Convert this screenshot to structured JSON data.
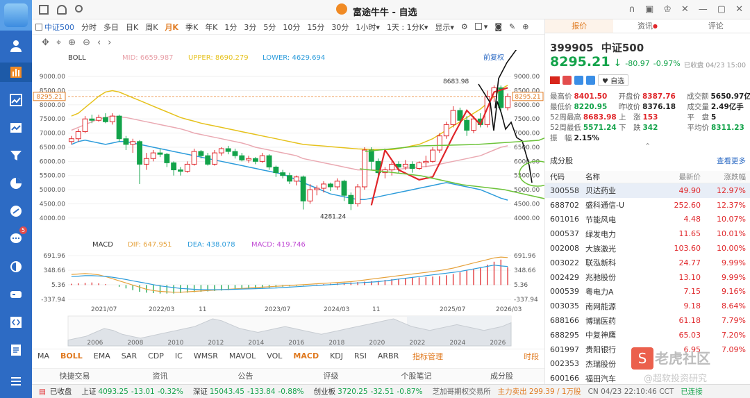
{
  "window": {
    "title": "富途牛牛 - 自选"
  },
  "toolbar": {
    "index_checkbox_label": "中证500",
    "periods": [
      "分时",
      "多日",
      "日K",
      "周K",
      "月K",
      "季K",
      "年K",
      "1分",
      "3分",
      "5分",
      "10分",
      "15分",
      "30分",
      "1小时▾",
      "1天 : 1分K▾",
      "显示▾"
    ],
    "active_period": "月K",
    "prev_adj_label": "前复权"
  },
  "boll": {
    "label": "BOLL",
    "mid_label": "MID:",
    "mid": "6659.987",
    "upper_label": "UPPER:",
    "upper": "8690.279",
    "lower_label": "LOWER:",
    "lower": "4629.694"
  },
  "macd": {
    "label": "MACD",
    "dif_label": "DIF:",
    "dif": "647.951",
    "dea_label": "DEA:",
    "dea": "438.078",
    "macd_label": "MACD:",
    "macd": "419.746"
  },
  "chart_data": [
    {
      "type": "candlestick",
      "title": "",
      "y_axis_ticks": [
        "9000.00",
        "8500.00",
        "8000.00",
        "7500.00",
        "7000.00",
        "6500.00",
        "6000.00",
        "5500.00",
        "5000.00",
        "4500.00",
        "4000.00"
      ],
      "ylim": [
        3750,
        9150
      ],
      "current_price_tag": "8295.21",
      "max_label": "8683.98",
      "min_label": "4281.24",
      "x_axis_labels": [
        "2021/07",
        "2022/03",
        "11",
        "2023/07",
        "2024/03",
        "11",
        "2025/07",
        "2026/03"
      ],
      "candles": [
        {
          "o": 6700,
          "c": 6800,
          "h": 6900,
          "l": 6600
        },
        {
          "o": 6800,
          "c": 7050,
          "h": 7150,
          "l": 6700
        },
        {
          "o": 7050,
          "c": 7500,
          "h": 7600,
          "l": 7000
        },
        {
          "o": 7500,
          "c": 7450,
          "h": 7650,
          "l": 7350
        },
        {
          "o": 7450,
          "c": 7550,
          "h": 7650,
          "l": 7400
        },
        {
          "o": 7550,
          "c": 7400,
          "h": 7700,
          "l": 7350
        },
        {
          "o": 7400,
          "c": 7600,
          "h": 7700,
          "l": 7300
        },
        {
          "o": 7600,
          "c": 6800,
          "h": 7650,
          "l": 6700
        },
        {
          "o": 6800,
          "c": 6600,
          "h": 6900,
          "l": 6400
        },
        {
          "o": 6600,
          "c": 6700,
          "h": 6800,
          "l": 6300
        },
        {
          "o": 6700,
          "c": 5900,
          "h": 6750,
          "l": 5200
        },
        {
          "o": 5900,
          "c": 6100,
          "h": 6300,
          "l": 5700
        },
        {
          "o": 6100,
          "c": 6300,
          "h": 6400,
          "l": 6000
        },
        {
          "o": 6300,
          "c": 6250,
          "h": 6450,
          "l": 6150
        },
        {
          "o": 6250,
          "c": 5950,
          "h": 6300,
          "l": 5800
        },
        {
          "o": 5950,
          "c": 5700,
          "h": 6000,
          "l": 5500
        },
        {
          "o": 5700,
          "c": 5650,
          "h": 5800,
          "l": 5500
        },
        {
          "o": 5650,
          "c": 5900,
          "h": 6000,
          "l": 5600
        },
        {
          "o": 5900,
          "c": 6350,
          "h": 6450,
          "l": 5850
        },
        {
          "o": 6350,
          "c": 6200,
          "h": 6400,
          "l": 6100
        },
        {
          "o": 6200,
          "c": 5900,
          "h": 6300,
          "l": 5850
        },
        {
          "o": 5900,
          "c": 6300,
          "h": 6400,
          "l": 5850
        },
        {
          "o": 6300,
          "c": 6450,
          "h": 6500,
          "l": 6200
        },
        {
          "o": 6450,
          "c": 6350,
          "h": 6550,
          "l": 6250
        },
        {
          "o": 6350,
          "c": 6200,
          "h": 6450,
          "l": 6100
        },
        {
          "o": 6200,
          "c": 6050,
          "h": 6300,
          "l": 6000
        },
        {
          "o": 6050,
          "c": 6100,
          "h": 6200,
          "l": 5950
        },
        {
          "o": 6100,
          "c": 6000,
          "h": 6150,
          "l": 5900
        },
        {
          "o": 6000,
          "c": 6200,
          "h": 6300,
          "l": 5950
        },
        {
          "o": 6200,
          "c": 5800,
          "h": 6250,
          "l": 5700
        },
        {
          "o": 5800,
          "c": 5600,
          "h": 5850,
          "l": 5450
        },
        {
          "o": 5600,
          "c": 5500,
          "h": 5700,
          "l": 5400
        },
        {
          "o": 5500,
          "c": 5300,
          "h": 5600,
          "l": 5200
        },
        {
          "o": 5300,
          "c": 5450,
          "h": 5500,
          "l": 5150
        },
        {
          "o": 5450,
          "c": 4600,
          "h": 5500,
          "l": 4300
        },
        {
          "o": 4600,
          "c": 5000,
          "h": 5200,
          "l": 4500
        },
        {
          "o": 5000,
          "c": 5050,
          "h": 5150,
          "l": 4800
        },
        {
          "o": 5050,
          "c": 5200,
          "h": 5300,
          "l": 4900
        },
        {
          "o": 5200,
          "c": 5100,
          "h": 5250,
          "l": 4950
        },
        {
          "o": 5100,
          "c": 5300,
          "h": 5400,
          "l": 5000
        },
        {
          "o": 5300,
          "c": 4800,
          "h": 5350,
          "l": 4600
        },
        {
          "o": 4800,
          "c": 4500,
          "h": 4900,
          "l": 4281
        },
        {
          "o": 4500,
          "c": 5100,
          "h": 5200,
          "l": 4400
        },
        {
          "o": 5100,
          "c": 6400,
          "h": 6500,
          "l": 5000
        },
        {
          "o": 6400,
          "c": 6000,
          "h": 6500,
          "l": 5700
        },
        {
          "o": 6000,
          "c": 5600,
          "h": 6100,
          "l": 5400
        },
        {
          "o": 5600,
          "c": 5700,
          "h": 5800,
          "l": 5400
        },
        {
          "o": 5700,
          "c": 5900,
          "h": 6000,
          "l": 5500
        },
        {
          "o": 5900,
          "c": 5800,
          "h": 6000,
          "l": 5600
        },
        {
          "o": 5800,
          "c": 5900,
          "h": 6050,
          "l": 5700
        },
        {
          "o": 5900,
          "c": 5750,
          "h": 6000,
          "l": 5600
        },
        {
          "o": 5750,
          "c": 5950,
          "h": 6000,
          "l": 5700
        },
        {
          "o": 5950,
          "c": 6000,
          "h": 6200,
          "l": 5800
        },
        {
          "o": 6000,
          "c": 6400,
          "h": 6500,
          "l": 5950
        },
        {
          "o": 6400,
          "c": 6900,
          "h": 7000,
          "l": 6300
        },
        {
          "o": 6900,
          "c": 7300,
          "h": 7400,
          "l": 6800
        },
        {
          "o": 7300,
          "c": 7800,
          "h": 7950,
          "l": 7200
        },
        {
          "o": 7800,
          "c": 7450,
          "h": 7900,
          "l": 7300
        },
        {
          "o": 7450,
          "c": 7100,
          "h": 7600,
          "l": 6900
        },
        {
          "o": 7100,
          "c": 7500,
          "h": 7600,
          "l": 7000
        },
        {
          "o": 7500,
          "c": 7300,
          "h": 7700,
          "l": 7200
        },
        {
          "o": 7300,
          "c": 8300,
          "h": 8500,
          "l": 7200
        },
        {
          "o": 8300,
          "c": 8600,
          "h": 8684,
          "l": 8100
        },
        {
          "o": 8600,
          "c": 7900,
          "h": 8680,
          "l": 7700
        },
        {
          "o": 7900,
          "c": 8295,
          "h": 8400,
          "l": 7800
        }
      ],
      "mid_line": [
        7100,
        7200,
        7300,
        7400,
        7500,
        7550,
        7600,
        7580,
        7550,
        7500,
        7450,
        7400,
        7350,
        7300,
        7250,
        7200,
        7150,
        7080,
        7000,
        6950,
        6900,
        6850,
        6800,
        6750,
        6700,
        6650,
        6580,
        6500,
        6450,
        6400,
        6350,
        6300,
        6250,
        6200,
        6100,
        6050,
        6000,
        5950,
        5900,
        5850,
        5800,
        5750,
        5700,
        5700,
        5700,
        5700,
        5700,
        5700,
        5720,
        5750,
        5780,
        5800,
        5820,
        5850,
        5900,
        5950,
        6000,
        6050,
        6100,
        6150,
        6200,
        6300,
        6400,
        6500,
        6550
      ],
      "upper_line": [
        7600,
        7700,
        7900,
        8100,
        8300,
        8450,
        8500,
        8450,
        8350,
        8250,
        8150,
        8050,
        7950,
        7850,
        7750,
        7650,
        7550,
        7480,
        7420,
        7350,
        7300,
        7250,
        7200,
        7150,
        7100,
        7050,
        7000,
        6950,
        6900,
        6850,
        6800,
        6750,
        6700,
        6650,
        6600,
        6580,
        6560,
        6540,
        6520,
        6500,
        6480,
        6460,
        6440,
        6430,
        6420,
        6420,
        6420,
        6420,
        6450,
        6500,
        6550,
        6600,
        6700,
        6800,
        6950,
        7100,
        7250,
        7400,
        7550,
        7700,
        7850,
        8050,
        8300,
        8550,
        8690
      ],
      "lower_line": [
        6600,
        6700,
        6750,
        6700,
        6650,
        6600,
        6650,
        6700,
        6700,
        6650,
        6600,
        6550,
        6500,
        6450,
        6400,
        6350,
        6300,
        6250,
        6200,
        6150,
        6100,
        6050,
        6000,
        5950,
        5900,
        5850,
        5800,
        5750,
        5700,
        5650,
        5600,
        5550,
        5450,
        5350,
        5250,
        5150,
        5050,
        4950,
        4850,
        4800,
        4750,
        4700,
        4650,
        4650,
        4700,
        4750,
        4800,
        4850,
        4900,
        4950,
        5000,
        5050,
        5100,
        5150,
        5200,
        5250,
        5200,
        5150,
        5100,
        5050,
        5000,
        4900,
        4800,
        4700,
        4630
      ]
    },
    {
      "type": "bar",
      "title": "MACD",
      "y_axis_ticks": [
        "691.96",
        "348.66",
        "5.36",
        "-337.94"
      ],
      "ylim": [
        -420,
        760
      ],
      "histogram": [
        30,
        40,
        50,
        60,
        40,
        20,
        0,
        -40,
        -80,
        -120,
        -160,
        -180,
        -190,
        -200,
        -200,
        -200,
        -190,
        -180,
        -170,
        -160,
        -150,
        -140,
        -130,
        -120,
        -110,
        -100,
        -90,
        -80,
        -70,
        -60,
        -50,
        -40,
        -30,
        -20,
        -10,
        0,
        10,
        20,
        30,
        40,
        50,
        60,
        70,
        80,
        90,
        100,
        120,
        140,
        150,
        160,
        170,
        180,
        190,
        200,
        210,
        230,
        260,
        300,
        340,
        380,
        420,
        480,
        550,
        600,
        420
      ],
      "dif_line": [
        250,
        260,
        270,
        260,
        240,
        200,
        150,
        100,
        50,
        0,
        -50,
        -100,
        -130,
        -150,
        -160,
        -170,
        -170,
        -160,
        -150,
        -140,
        -130,
        -120,
        -110,
        -100,
        -90,
        -80,
        -70,
        -60,
        -50,
        -40,
        -30,
        -20,
        -10,
        0,
        10,
        20,
        30,
        40,
        50,
        60,
        70,
        80,
        100,
        120,
        140,
        160,
        180,
        200,
        220,
        240,
        260,
        280,
        300,
        320,
        340,
        370,
        400,
        440,
        480,
        520,
        560,
        600,
        640,
        660,
        648
      ],
      "dea_line": [
        200,
        210,
        220,
        220,
        215,
        205,
        185,
        160,
        130,
        100,
        70,
        40,
        10,
        -20,
        -40,
        -60,
        -80,
        -90,
        -100,
        -105,
        -110,
        -110,
        -108,
        -105,
        -100,
        -95,
        -90,
        -85,
        -80,
        -75,
        -70,
        -60,
        -50,
        -40,
        -30,
        -20,
        -10,
        0,
        10,
        20,
        30,
        40,
        50,
        60,
        70,
        80,
        100,
        120,
        140,
        160,
        180,
        200,
        220,
        240,
        260,
        280,
        300,
        320,
        350,
        380,
        410,
        440,
        470,
        450,
        438
      ]
    },
    {
      "type": "area",
      "title": "",
      "x_axis_labels": [
        "2006",
        "2008",
        "2010",
        "2012",
        "2014",
        "2016",
        "2018",
        "2020",
        "2022",
        "2024",
        "2026"
      ],
      "values": [
        3,
        4,
        5,
        7,
        9,
        8,
        6,
        5,
        4,
        5,
        6,
        7,
        8,
        9,
        10,
        12,
        14,
        13,
        11,
        9,
        8,
        7,
        8,
        9,
        10,
        9,
        8,
        7,
        6,
        7,
        8,
        9,
        10,
        11,
        12,
        13,
        14,
        12,
        10,
        9,
        8,
        9,
        10,
        11,
        10,
        9,
        8,
        9,
        10,
        12
      ]
    }
  ],
  "subtabs": [
    "MA",
    "BOLL",
    "EMA",
    "SAR",
    "CDP",
    "IC",
    "WMSR",
    "MAVOL",
    "VOL",
    "MACD",
    "KDJ",
    "RSI",
    "ARBR"
  ],
  "subtabs_active": [
    "BOLL",
    "MACD"
  ],
  "subtab_right": {
    "indicator_mgmt": "指标管理",
    "timeframe": "时段"
  },
  "bottom_tabs": [
    "快捷交易",
    "资讯",
    "公告",
    "评级",
    "个股笔记",
    "成分股"
  ],
  "right_panel": {
    "tabs": [
      "报价",
      "资讯",
      "评论"
    ],
    "active_tab": "报价",
    "code": "399905",
    "name": "中证500",
    "price": "8295.21",
    "change": "-80.97",
    "change_pct": "-0.97%",
    "status": "已收盘 04/23 15:00",
    "watch_label": "自选",
    "quotes": [
      [
        {
          "k": "最高价",
          "v": "8401.50",
          "c": "red"
        },
        {
          "k": "开盘价",
          "v": "8387.76",
          "c": "red"
        },
        {
          "k": "成交额",
          "v": "5650.97亿",
          "c": "dark"
        }
      ],
      [
        {
          "k": "最低价",
          "v": "8220.95",
          "c": "green"
        },
        {
          "k": "昨收价",
          "v": "8376.18",
          "c": "dark"
        },
        {
          "k": "成交量",
          "v": "2.49亿手",
          "c": "dark"
        }
      ],
      [
        {
          "k": "52周最高",
          "v": "8683.98",
          "c": "red"
        },
        {
          "k": "上　涨",
          "v": "153",
          "c": "red"
        },
        {
          "k": "平　盘",
          "v": "5",
          "c": "dark"
        }
      ],
      [
        {
          "k": "52周最低",
          "v": "5571.24",
          "c": "green"
        },
        {
          "k": "下　跌",
          "v": "342",
          "c": "green"
        },
        {
          "k": "平均价",
          "v": "8311.23",
          "c": "green"
        }
      ],
      [
        {
          "k": "振　幅",
          "v": "2.15%",
          "c": "dark"
        }
      ]
    ],
    "constituents_title": "成分股",
    "see_more": "查看更多",
    "list_headers": [
      "代码",
      "名称",
      "最新价",
      "涨跌幅"
    ],
    "stocks": [
      {
        "code": "300558",
        "name": "贝达药业",
        "price": "49.90",
        "pct": "12.97%"
      },
      {
        "code": "688702",
        "name": "盛科通信-U",
        "price": "252.60",
        "pct": "12.37%"
      },
      {
        "code": "601016",
        "name": "节能风电",
        "price": "4.48",
        "pct": "10.07%"
      },
      {
        "code": "000537",
        "name": "绿发电力",
        "price": "11.65",
        "pct": "10.01%"
      },
      {
        "code": "002008",
        "name": "大族激光",
        "price": "103.60",
        "pct": "10.00%"
      },
      {
        "code": "003022",
        "name": "联泓新科",
        "price": "24.77",
        "pct": "9.99%"
      },
      {
        "code": "002429",
        "name": "兆驰股份",
        "price": "13.10",
        "pct": "9.99%"
      },
      {
        "code": "000539",
        "name": "粤电力A",
        "price": "7.15",
        "pct": "9.16%"
      },
      {
        "code": "003035",
        "name": "南网能源",
        "price": "9.18",
        "pct": "8.64%"
      },
      {
        "code": "688166",
        "name": "博瑞医药",
        "price": "61.18",
        "pct": "7.79%"
      },
      {
        "code": "688295",
        "name": "中复神鹰",
        "price": "65.03",
        "pct": "7.20%"
      },
      {
        "code": "601997",
        "name": "贵阳银行",
        "price": "6.95",
        "pct": "7.09%"
      },
      {
        "code": "002353",
        "name": "杰瑞股份",
        "price": "",
        "pct": ""
      },
      {
        "code": "600166",
        "name": "福田汽车",
        "price": "",
        "pct": ""
      }
    ]
  },
  "status_bar": {
    "market_status": "已收盘",
    "indices": [
      {
        "name": "上证",
        "value": "4093.25",
        "change": "-13.01",
        "pct": "-0.32%"
      },
      {
        "name": "深证",
        "value": "15043.45",
        "change": "-133.84",
        "pct": "-0.88%"
      },
      {
        "name": "创业板",
        "value": "3720.25",
        "change": "-32.51",
        "pct": "-0.87%"
      }
    ],
    "exchange": "芝加哥期权交易所",
    "flow": "主力卖出 299.39 / 1万股",
    "time": "CN 04/23 22:10:46 CCT",
    "connected": "已连接"
  },
  "watermark": {
    "text1": "老虎社区",
    "text2": "@超软投资研究"
  },
  "colors": {
    "accent": "#e07a20",
    "red": "#e0262a",
    "green": "#13a34a",
    "sidebar": "#2d6bc4"
  }
}
